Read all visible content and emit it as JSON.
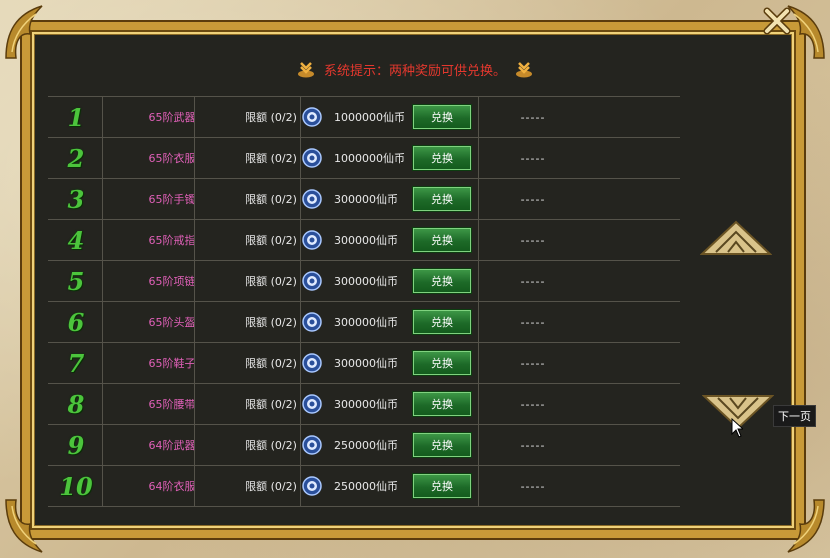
{
  "notice": {
    "text": "系统提示：两种奖励可供兑换。"
  },
  "rows": [
    {
      "num": "1",
      "item": "65阶武器",
      "limit": "限额 (0/2)",
      "cost": "1000000仙币",
      "button": "兑换",
      "status": "-----"
    },
    {
      "num": "2",
      "item": "65阶衣服",
      "limit": "限额 (0/2)",
      "cost": "1000000仙币",
      "button": "兑换",
      "status": "-----"
    },
    {
      "num": "3",
      "item": "65阶手镯",
      "limit": "限额 (0/2)",
      "cost": "300000仙币",
      "button": "兑换",
      "status": "-----"
    },
    {
      "num": "4",
      "item": "65阶戒指",
      "limit": "限额 (0/2)",
      "cost": "300000仙币",
      "button": "兑换",
      "status": "-----"
    },
    {
      "num": "5",
      "item": "65阶项链",
      "limit": "限额 (0/2)",
      "cost": "300000仙币",
      "button": "兑换",
      "status": "-----"
    },
    {
      "num": "6",
      "item": "65阶头盔",
      "limit": "限额 (0/2)",
      "cost": "300000仙币",
      "button": "兑换",
      "status": "-----"
    },
    {
      "num": "7",
      "item": "65阶鞋子",
      "limit": "限额 (0/2)",
      "cost": "300000仙币",
      "button": "兑换",
      "status": "-----"
    },
    {
      "num": "8",
      "item": "65阶腰带",
      "limit": "限额 (0/2)",
      "cost": "300000仙币",
      "button": "兑换",
      "status": "-----"
    },
    {
      "num": "9",
      "item": "64阶武器",
      "limit": "限额 (0/2)",
      "cost": "250000仙币",
      "button": "兑换",
      "status": "-----"
    },
    {
      "num": "10",
      "item": "64阶衣服",
      "limit": "限额 (0/2)",
      "cost": "250000仙币",
      "button": "兑换",
      "status": "-----"
    }
  ],
  "nav": {
    "next_tooltip": "下一页"
  },
  "colors": {
    "accent_green": "#4cc43c",
    "item_pink": "#e060b8",
    "notice_red": "#e4382e",
    "frame_gold": "#c89a38"
  },
  "icons": {
    "coin": "coin-icon",
    "close": "close-icon",
    "notice": "notice-bullet-icon",
    "prev": "page-up-arrow-icon",
    "next": "page-down-arrow-icon"
  }
}
